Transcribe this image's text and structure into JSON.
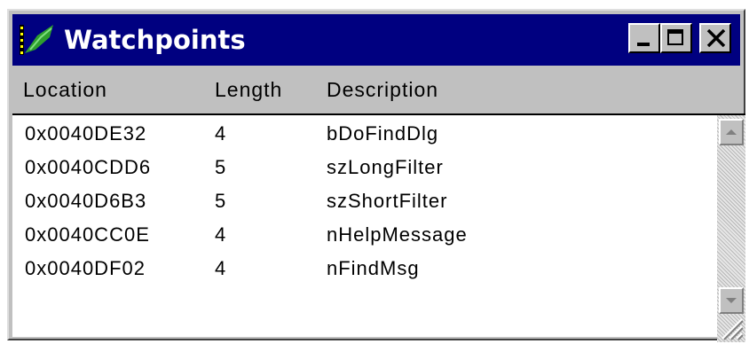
{
  "window": {
    "title": "Watchpoints"
  },
  "columns": {
    "location": "Location",
    "length": "Length",
    "description": "Description"
  },
  "rows": [
    {
      "location": "0x0040DE32",
      "length": "4",
      "description": "bDoFindDlg"
    },
    {
      "location": "0x0040CDD6",
      "length": "5",
      "description": "szLongFilter"
    },
    {
      "location": "0x0040D6B3",
      "length": "5",
      "description": "szShortFilter"
    },
    {
      "location": "0x0040CC0E",
      "length": "4",
      "description": "nHelpMessage"
    },
    {
      "location": "0x0040DF02",
      "length": "4",
      "description": "nFindMsg"
    }
  ],
  "icons": {
    "app": "watchpoints-app-icon",
    "minimize": "minimize-icon",
    "maximize": "maximize-icon",
    "close": "close-icon",
    "scroll_up": "arrow-up-icon",
    "scroll_down": "arrow-down-icon",
    "resize": "resize-grip-icon"
  },
  "colors": {
    "titlebar": "#000080",
    "face": "#c0c0c0"
  }
}
